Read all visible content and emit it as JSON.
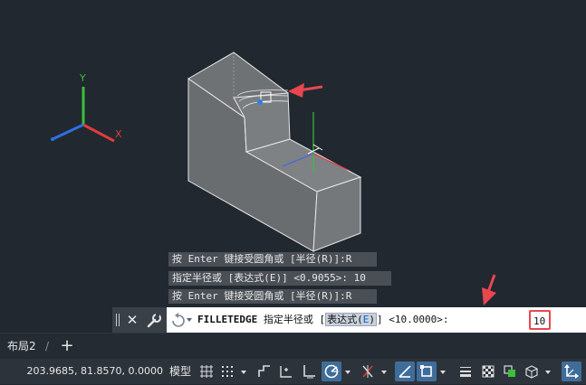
{
  "history": {
    "line1": "按 Enter 键接受圆角或 [半径(R)]:R",
    "line2": "指定半径或 [表达式(E)] <0.9055>: 10",
    "line3": "按 Enter 键接受圆角或 [半径(R)]:R"
  },
  "command": {
    "close_glyph": "✕",
    "name": "FILLETEDGE",
    "prompt_before": " 指定半径或 [",
    "option_label": "表达式(",
    "option_key": "E",
    "option_close": ")",
    "prompt_after": "] <10.0000>: ",
    "input_value": "10"
  },
  "axes": {
    "x_label": "X",
    "y_label": "Y"
  },
  "tabs": {
    "layout2": "布局2",
    "separator": "/",
    "add": "+"
  },
  "status": {
    "coordinates": "203.9685, 81.8570, 0.0000",
    "model": "模型"
  },
  "colors": {
    "background": "#212830",
    "annotation_red": "#e8474f",
    "x_axis": "#e03c3c",
    "y_axis": "#3cbf3c",
    "z_axis": "#2f6fe0"
  }
}
